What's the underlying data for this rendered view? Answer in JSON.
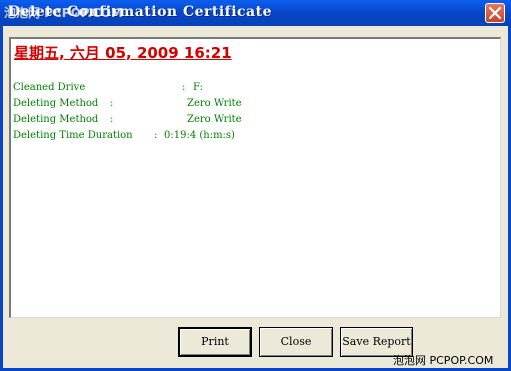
{
  "window": {
    "title": "Delete Confirmation Certificate",
    "title_watermark": "泡泡网 PCPOP.COM",
    "close_label": "Close window"
  },
  "report": {
    "date": "星期五, 六月 05, 2009 16:21",
    "lines": [
      {
        "label": "Cleaned Drive",
        "sep": ":",
        "value": "F:"
      },
      {
        "label": "Deleting Method",
        "sep": ":",
        "value": "Zero Write"
      },
      {
        "label": "Deleting Method",
        "sep": ":",
        "value": "Zero Write"
      },
      {
        "label": "Deleting Time Duration",
        "sep": ":",
        "value": "0:19:4 (h:m:s)"
      }
    ]
  },
  "buttons": {
    "print": "Print",
    "close": "Close",
    "save_report": "Save Report"
  },
  "watermark": "泡泡网 PCPOP.COM",
  "colors": {
    "title_bar": "#0846c8",
    "date_text": "#d40000",
    "report_text": "#008000",
    "dialog_bg": "#ece9d8"
  }
}
